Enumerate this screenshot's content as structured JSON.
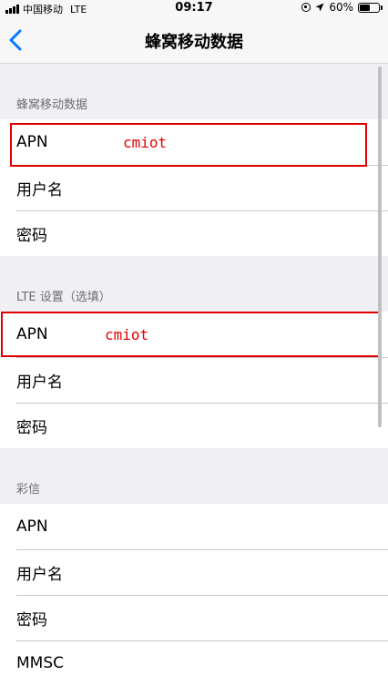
{
  "status_bar": {
    "carrier": "中国移动",
    "network": "LTE",
    "time": "09:17",
    "battery_text": "60%",
    "battery_level": 0.6
  },
  "nav": {
    "title": "蜂窝移动数据"
  },
  "sections": {
    "cellular": {
      "header": "蜂窝移动数据",
      "apn_label": "APN",
      "apn_value": "cmiot",
      "username_label": "用户名",
      "password_label": "密码"
    },
    "lte": {
      "header": "LTE 设置（选填）",
      "apn_label": "APN",
      "apn_value": "cmiot",
      "username_label": "用户名",
      "password_label": "密码"
    },
    "mms": {
      "header": "彩信",
      "apn_label": "APN",
      "username_label": "用户名",
      "password_label": "密码",
      "mmsc_label": "MMSC"
    }
  },
  "colors": {
    "accent": "#007aff",
    "annotation": "#e00000",
    "background": "#efeff4"
  }
}
